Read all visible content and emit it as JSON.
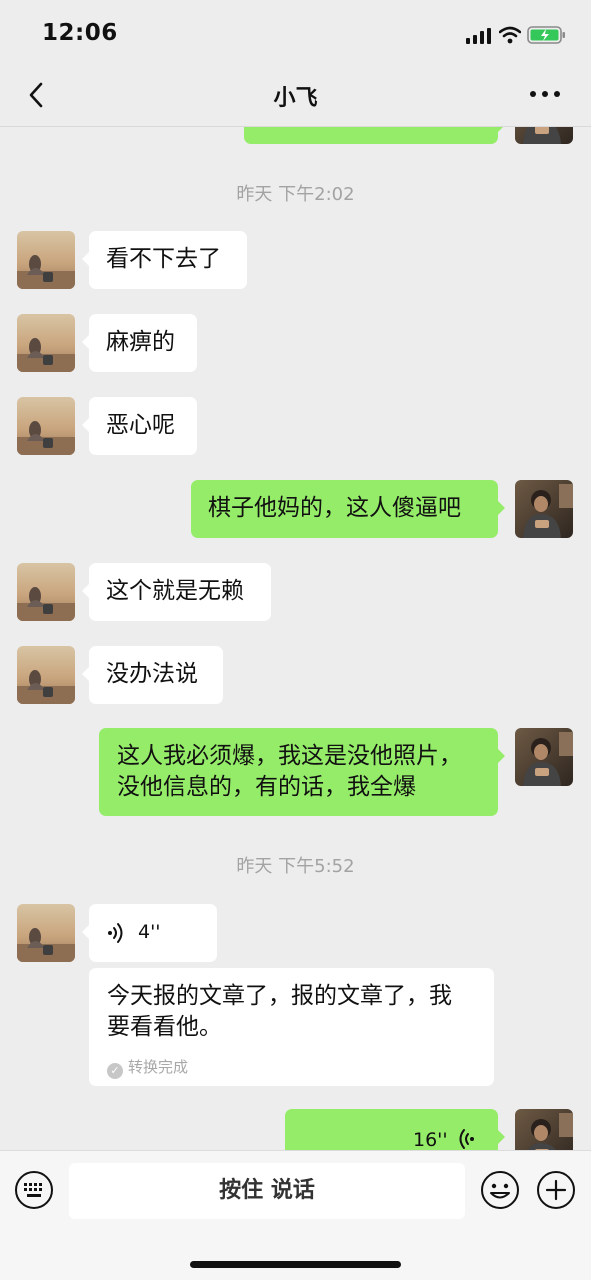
{
  "status_bar": {
    "time": "12:06"
  },
  "header": {
    "title": "小飞"
  },
  "messages": {
    "ts1": "昨天 下午2:02",
    "m1": "看不下去了",
    "m2": "麻痹的",
    "m3": "恶心呢",
    "m4": "棋子他妈的，这人傻逼吧",
    "m5": "这个就是无赖",
    "m6": "没办法说",
    "m7_line1": "这人我必须爆，我这是没他照片，",
    "m7_line2": "没他信息的，有的话，我全爆",
    "ts2": "昨天 下午5:52",
    "voice_left_duration": "4''",
    "transcript_line1": "今天报的文章了，报的文章了，我",
    "transcript_line2": "要看看他。",
    "transcript_status": "转换完成",
    "voice_right_duration": "16''"
  },
  "input_bar": {
    "hold_to_talk_label": "按住 说话"
  },
  "colors": {
    "sent_bubble": "#95ec69",
    "received_bubble": "#ffffff",
    "background": "#ededed"
  },
  "icons": [
    "back-icon",
    "more-icon",
    "voice-wave-icon",
    "keyboard-icon",
    "emoji-icon",
    "plus-icon"
  ]
}
